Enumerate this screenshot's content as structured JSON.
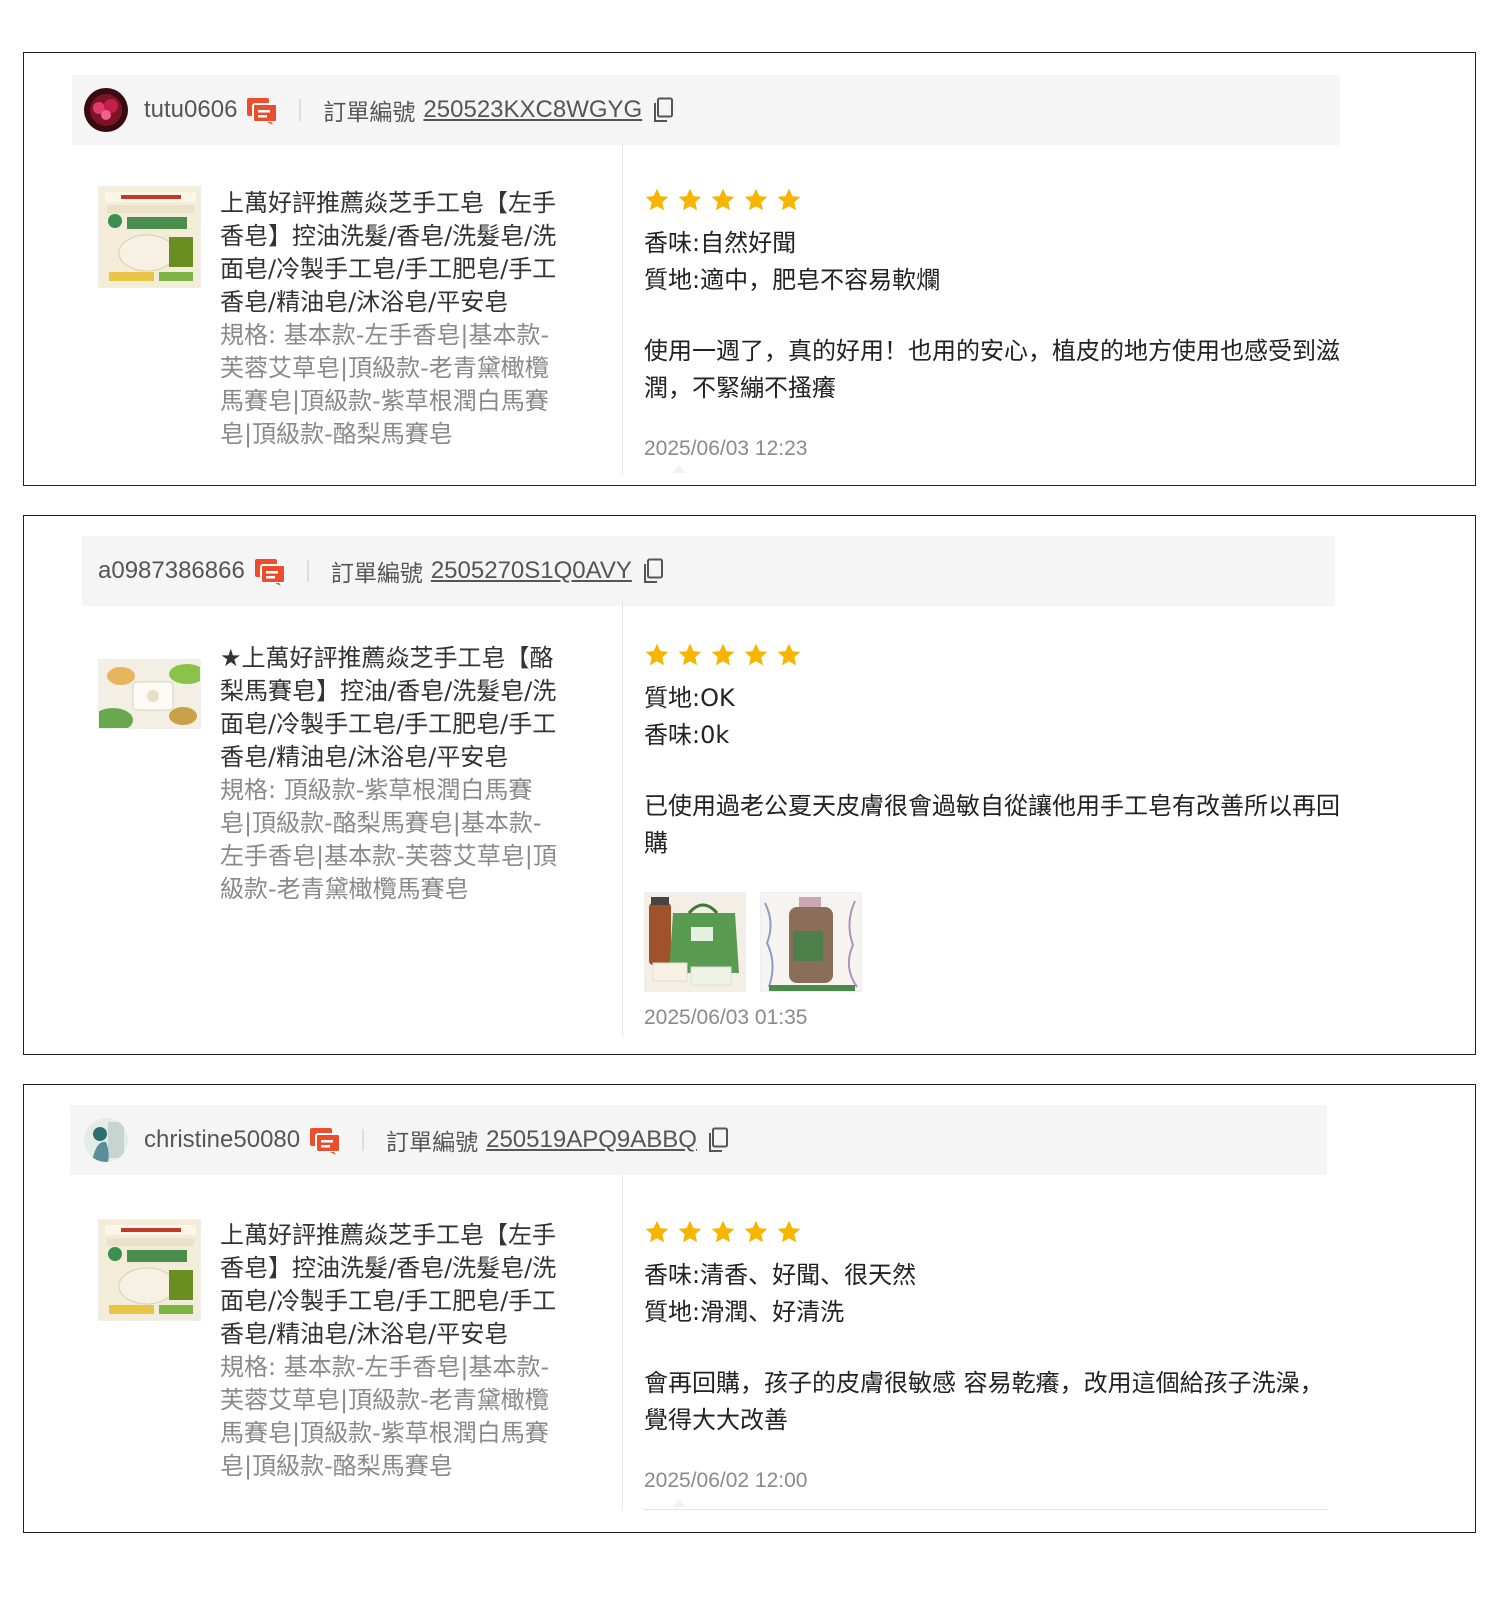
{
  "reviews": [
    {
      "username": "tutu0606",
      "order_label": "訂單編號",
      "order_no": "250523KXC8WGYG",
      "product_title": "上萬好評推薦焱芝手工皂【左手香皂】控油洗髮/香皂/洗髮皂/洗面皂/冷製手工皂/手工肥皂/手工香皂/精油皂/沐浴皂/平安皂",
      "product_spec": "規格: 基本款-左手香皂|基本款-芙蓉艾草皂|頂級款-老青黛橄欖馬賽皂|頂級款-紫草根潤白馬賽皂|頂級款-酪梨馬賽皂",
      "rating": 5,
      "attr1": "香味:自然好聞",
      "attr2": "質地:適中，肥皂不容易軟爛",
      "text": "使用一週了，真的好用！也用的安心，植皮的地方使用也感受到滋潤，不緊繃不搔癢",
      "date": "2025/06/03 12:23"
    },
    {
      "username": "a0987386866",
      "order_label": "訂單編號",
      "order_no": "2505270S1Q0AVY",
      "product_title": "★上萬好評推薦焱芝手工皂【酪梨馬賽皂】控油/香皂/洗髮皂/洗面皂/冷製手工皂/手工肥皂/手工香皂/精油皂/沐浴皂/平安皂",
      "product_spec": "規格: 頂級款-紫草根潤白馬賽皂|頂級款-酪梨馬賽皂|基本款-左手香皂|基本款-芙蓉艾草皂|頂級款-老青黛橄欖馬賽皂",
      "rating": 5,
      "attr1": "質地:OK",
      "attr2": "香味:0k",
      "text": "已使用過老公夏天皮膚很會過敏自從讓他用手工皂有改善所以再回購",
      "date": "2025/06/03 01:35"
    },
    {
      "username": "christine50080",
      "order_label": "訂單編號",
      "order_no": "250519APQ9ABBQ",
      "product_title": "上萬好評推薦焱芝手工皂【左手香皂】控油洗髮/香皂/洗髮皂/洗面皂/冷製手工皂/手工肥皂/手工香皂/精油皂/沐浴皂/平安皂",
      "product_spec": "規格: 基本款-左手香皂|基本款-芙蓉艾草皂|頂級款-老青黛橄欖馬賽皂|頂級款-紫草根潤白馬賽皂|頂級款-酪梨馬賽皂",
      "rating": 5,
      "attr1": "香味:清香、好聞、很天然",
      "attr2": "質地:滑潤、好清洗",
      "text": "會再回購，孩子的皮膚很敏感 容易乾癢，改用這個給孩子洗澡，覺得大大改善",
      "date": "2025/06/02 12:00"
    }
  ],
  "colors": {
    "star": "#f7b500",
    "chat_icon": "#ee4d2d",
    "header_bg": "#f5f5f5",
    "spec_text": "#8a8a8a"
  },
  "icons": [
    "chat-icon",
    "copy-icon",
    "star-icon"
  ]
}
